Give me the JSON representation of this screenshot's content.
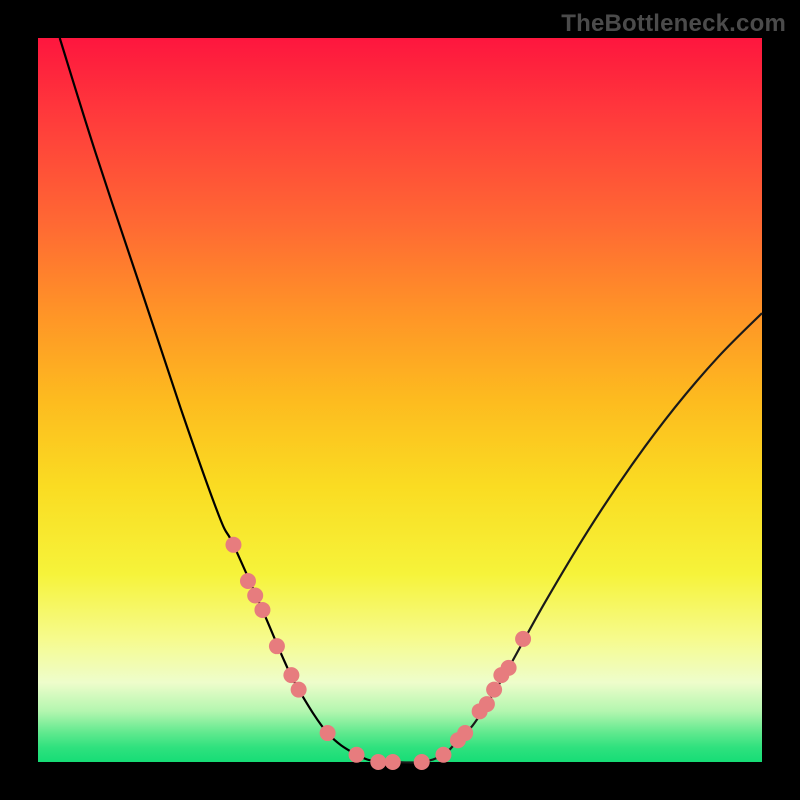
{
  "watermark": "TheBottleneck.com",
  "colors": {
    "gradient_top": "#fe163e",
    "gradient_bottom": "#16dd76",
    "curve": "#000000",
    "dot": "#e77c7e",
    "frame": "#000000"
  },
  "chart_data": {
    "type": "line",
    "title": "",
    "xlabel": "",
    "ylabel": "",
    "xlim": [
      0,
      100
    ],
    "ylim": [
      0,
      100
    ],
    "series": [
      {
        "name": "left-curve",
        "x": [
          3,
          8,
          14,
          20,
          25,
          27,
          31,
          34,
          36,
          40,
          44,
          47,
          49
        ],
        "y": [
          100,
          84,
          66,
          48,
          34,
          30,
          21,
          14,
          10,
          4,
          1,
          0,
          0
        ]
      },
      {
        "name": "right-curve",
        "x": [
          49,
          53,
          56,
          58,
          60,
          62,
          65,
          70,
          76,
          82,
          88,
          94,
          100
        ],
        "y": [
          0,
          0,
          1,
          3,
          5,
          8,
          13,
          22,
          32,
          41,
          49,
          56,
          62
        ]
      }
    ],
    "markers": {
      "name": "dots",
      "x": [
        27,
        29,
        30,
        31,
        33,
        35,
        36,
        40,
        44,
        47,
        49,
        53,
        56,
        58,
        59,
        61,
        62,
        63,
        64,
        65,
        67
      ],
      "y": [
        30,
        25,
        23,
        21,
        16,
        12,
        10,
        4,
        1,
        0,
        0,
        0,
        1,
        3,
        4,
        7,
        8,
        10,
        12,
        13,
        17
      ]
    }
  }
}
